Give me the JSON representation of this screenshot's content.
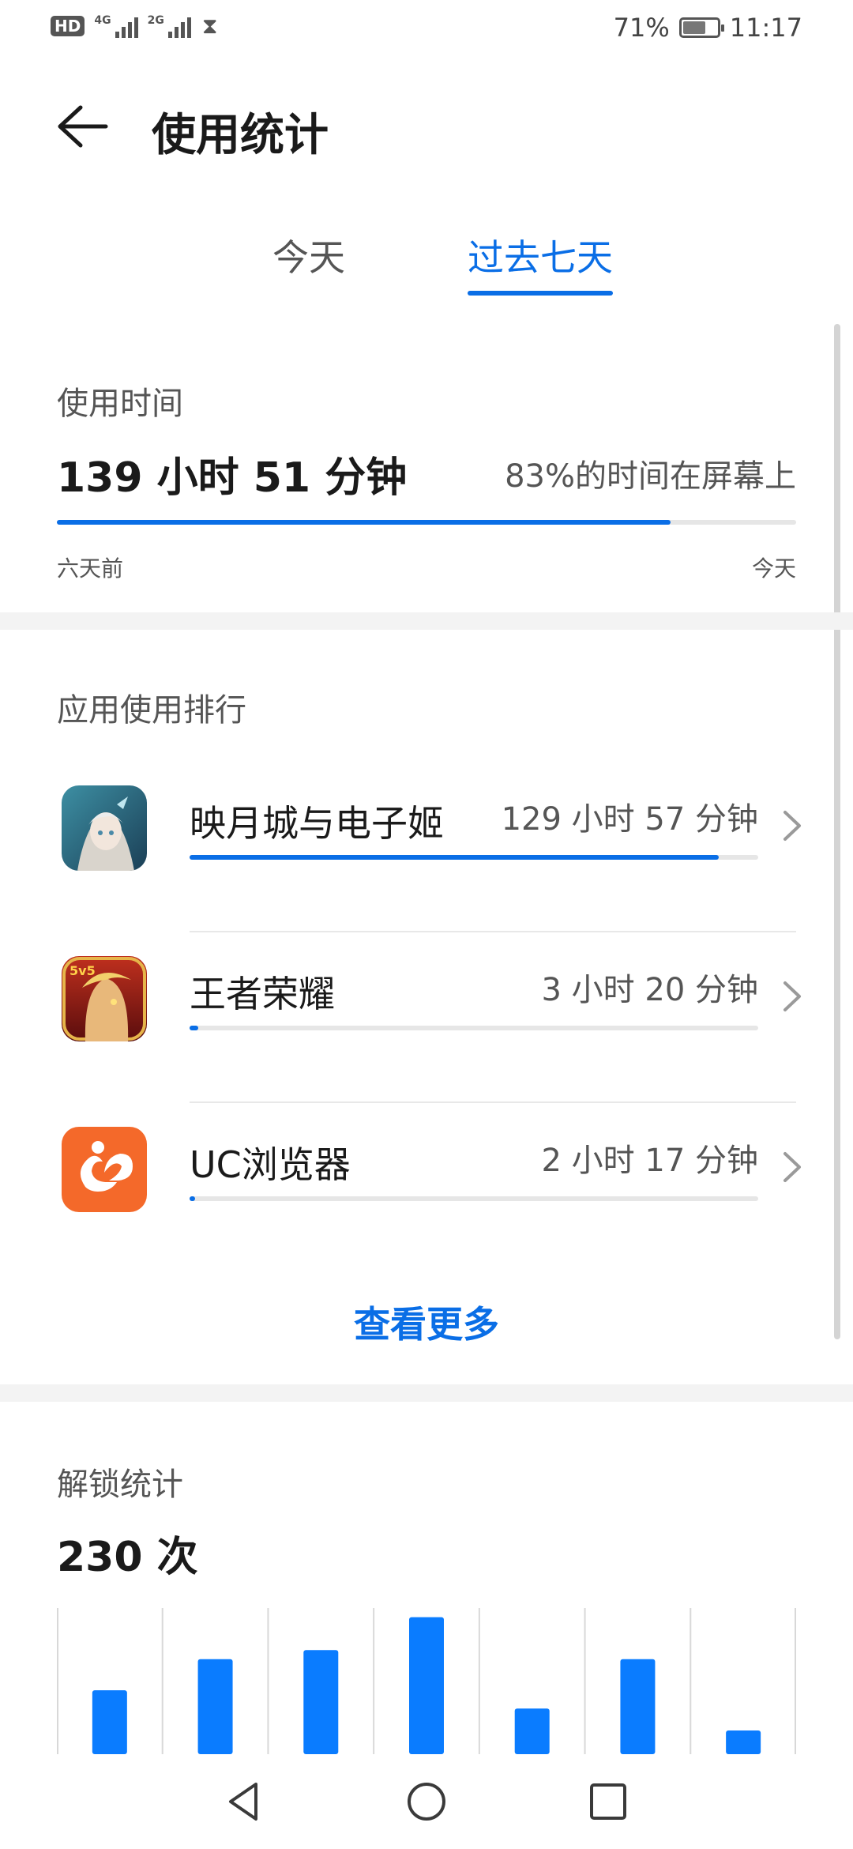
{
  "status_bar": {
    "hd": "HD",
    "signal1_label": "4G",
    "signal2_label": "2G",
    "battery_percent": "71%",
    "battery_level": 0.71,
    "time": "11:17"
  },
  "header": {
    "title": "使用统计"
  },
  "tabs": [
    {
      "label": "今天",
      "active": false
    },
    {
      "label": "过去七天",
      "active": true
    }
  ],
  "usage": {
    "label": "使用时间",
    "total": "139 小时 51 分钟",
    "screen_percent_text": "83%的时间在屏幕上",
    "progress": 0.83,
    "range_start": "六天前",
    "range_end": "今天"
  },
  "ranking": {
    "label": "应用使用排行",
    "apps": [
      {
        "name": "映月城与电子姬",
        "time": "129 小时 57 分钟",
        "fraction": 0.93
      },
      {
        "name": "王者荣耀",
        "time": "3 小时 20 分钟",
        "fraction": 0.015
      },
      {
        "name": "UC浏览器",
        "time": "2 小时 17 分钟",
        "fraction": 0.01
      }
    ],
    "see_more": "查看更多"
  },
  "unlock": {
    "label": "解锁统计",
    "total": "230 次"
  },
  "chart_data": {
    "type": "bar",
    "values": [
      35,
      52,
      57,
      75,
      25,
      52,
      13
    ],
    "color": "#0a7cff"
  },
  "colors": {
    "accent": "#0a6ee6"
  }
}
